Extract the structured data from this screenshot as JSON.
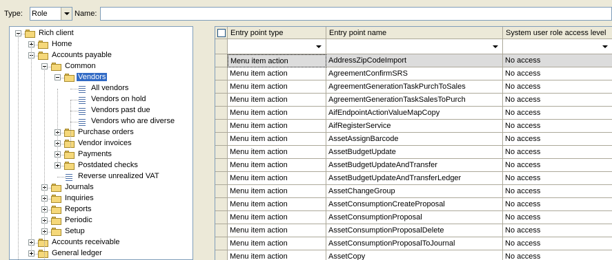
{
  "filter": {
    "type_label": "Type:",
    "type_value": "Role",
    "name_label": "Name:",
    "name_value": ""
  },
  "tree": {
    "nodes": [
      {
        "label": "Rich client",
        "icon": "folder-icon"
      },
      {
        "label": "Home",
        "icon": "folder-icon"
      },
      {
        "label": "Accounts payable",
        "icon": "folder-icon"
      },
      {
        "label": "Common",
        "icon": "folder-icon"
      },
      {
        "label": "Vendors",
        "icon": "folder-icon",
        "selected": true
      },
      {
        "label": "All vendors",
        "icon": "menu-item-icon"
      },
      {
        "label": "Vendors on hold",
        "icon": "menu-item-icon"
      },
      {
        "label": "Vendors past due",
        "icon": "menu-item-icon"
      },
      {
        "label": "Vendors who are diverse",
        "icon": "menu-item-icon"
      },
      {
        "label": "Purchase orders",
        "icon": "folder-icon"
      },
      {
        "label": "Vendor invoices",
        "icon": "folder-icon"
      },
      {
        "label": "Payments",
        "icon": "folder-icon"
      },
      {
        "label": "Postdated checks",
        "icon": "folder-icon"
      },
      {
        "label": "Reverse unrealized VAT",
        "icon": "menu-item-icon"
      },
      {
        "label": "Journals",
        "icon": "folder-icon"
      },
      {
        "label": "Inquiries",
        "icon": "folder-icon"
      },
      {
        "label": "Reports",
        "icon": "folder-icon"
      },
      {
        "label": "Periodic",
        "icon": "folder-icon"
      },
      {
        "label": "Setup",
        "icon": "folder-icon"
      },
      {
        "label": "Accounts receivable",
        "icon": "folder-icon"
      },
      {
        "label": "General ledger",
        "icon": "folder-icon"
      }
    ]
  },
  "grid": {
    "columns": [
      "Entry point type",
      "Entry point name",
      "System user role access level"
    ],
    "rows": [
      [
        "Menu item action",
        "AddressZipCodeImport",
        "No access"
      ],
      [
        "Menu item action",
        "AgreementConfirmSRS",
        "No access"
      ],
      [
        "Menu item action",
        "AgreementGenerationTaskPurchToSales",
        "No access"
      ],
      [
        "Menu item action",
        "AgreementGenerationTaskSalesToPurch",
        "No access"
      ],
      [
        "Menu item action",
        "AifEndpointActionValueMapCopy",
        "No access"
      ],
      [
        "Menu item action",
        "AifRegisterService",
        "No access"
      ],
      [
        "Menu item action",
        "AssetAssignBarcode",
        "No access"
      ],
      [
        "Menu item action",
        "AssetBudgetUpdate",
        "No access"
      ],
      [
        "Menu item action",
        "AssetBudgetUpdateAndTransfer",
        "No access"
      ],
      [
        "Menu item action",
        "AssetBudgetUpdateAndTransferLedger",
        "No access"
      ],
      [
        "Menu item action",
        "AssetChangeGroup",
        "No access"
      ],
      [
        "Menu item action",
        "AssetConsumptionCreateProposal",
        "No access"
      ],
      [
        "Menu item action",
        "AssetConsumptionProposal",
        "No access"
      ],
      [
        "Menu item action",
        "AssetConsumptionProposalDelete",
        "No access"
      ],
      [
        "Menu item action",
        "AssetConsumptionProposalToJournal",
        "No access"
      ],
      [
        "Menu item action",
        "AssetCopy",
        "No access"
      ]
    ]
  }
}
